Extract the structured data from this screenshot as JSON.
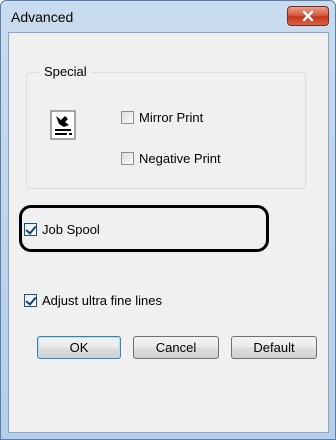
{
  "window": {
    "title": "Advanced"
  },
  "special_group": {
    "label": "Special",
    "mirror_print": {
      "label": "Mirror Print",
      "checked": false
    },
    "negative_print": {
      "label": "Negative Print",
      "checked": false
    }
  },
  "job_spool": {
    "label": "Job Spool",
    "checked": true
  },
  "adjust_lines": {
    "label": "Adjust ultra fine lines",
    "checked": true
  },
  "buttons": {
    "ok": "OK",
    "cancel": "Cancel",
    "default": "Default"
  },
  "colors": {
    "title_gradient": "#c9dcef",
    "close_red": "#c4361b",
    "dialog_bg": "#f0f0f0",
    "highlight_border": "#000000"
  },
  "icons": {
    "close": "close-icon",
    "printer": "printer-icon"
  }
}
